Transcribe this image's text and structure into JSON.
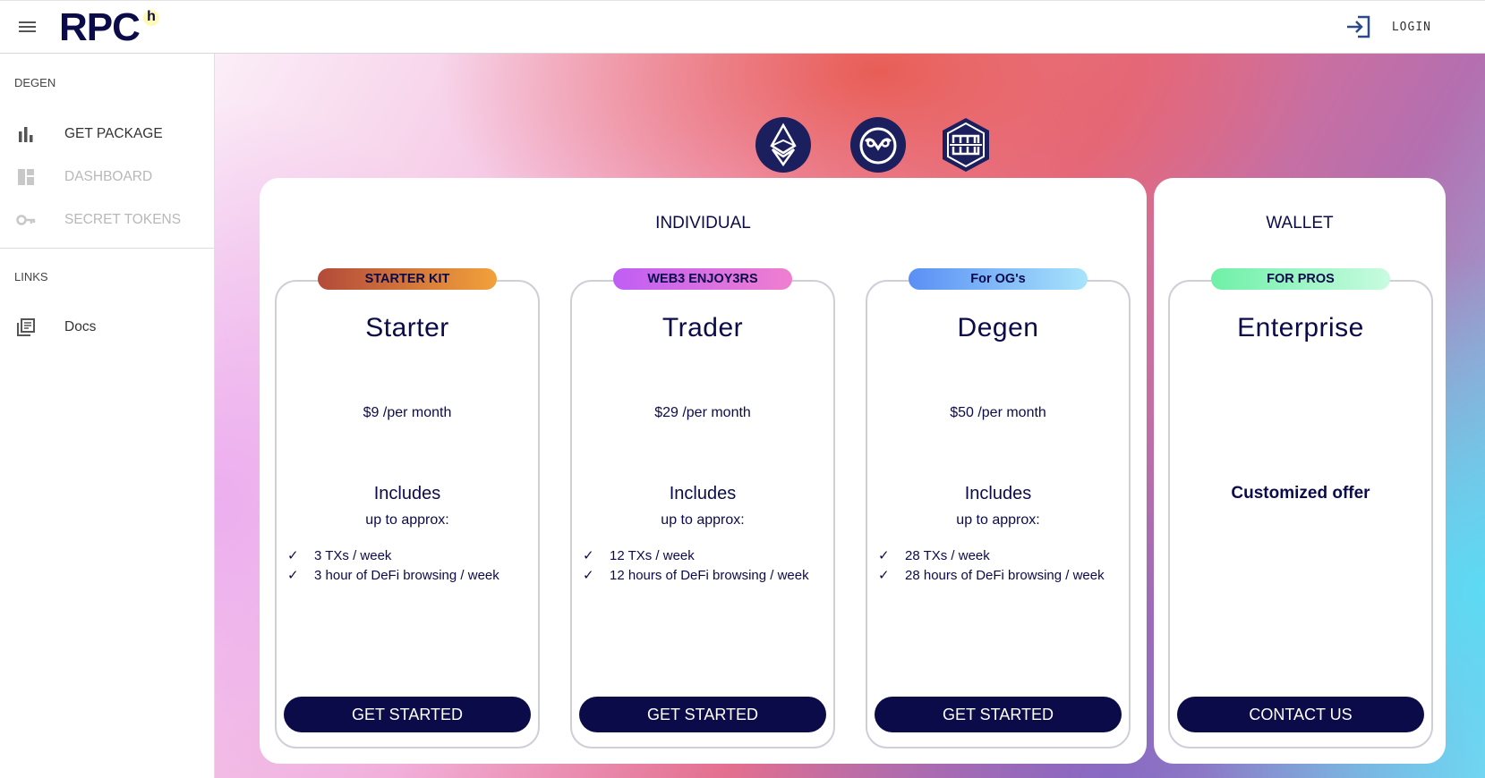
{
  "header": {
    "logo": "RPC",
    "logo_sup": "h",
    "login_label": "LOGIN"
  },
  "sidebar": {
    "section1": "DEGEN",
    "items": [
      {
        "label": "GET PACKAGE",
        "icon": "bar-chart-icon",
        "color": "#333333"
      },
      {
        "label": "DASHBOARD",
        "icon": "dashboard-icon",
        "color": "#b8b8b8"
      },
      {
        "label": "SECRET TOKENS",
        "icon": "key-icon",
        "color": "#b8b8b8"
      }
    ],
    "section2": "LINKS",
    "links": [
      {
        "label": "Docs",
        "icon": "library-books-icon",
        "color": "#333333"
      }
    ]
  },
  "chains": [
    "ethereum-icon",
    "gnosis-icon",
    "hoprnet-icon"
  ],
  "panels": {
    "individual_title": "INDIVIDUAL",
    "wallet_title": "WALLET"
  },
  "plans": [
    {
      "badge": "STARTER KIT",
      "badge_colors": [
        "#b34a3a",
        "#f2a13a"
      ],
      "title": "Starter",
      "price": "$9 /per month",
      "includes": "Includes",
      "includes_sub": "up to approx:",
      "features": [
        "3 TXs / week",
        "3 hour of DeFi browsing / week"
      ],
      "cta": "GET STARTED"
    },
    {
      "badge": "WEB3 ENJOY3RS",
      "badge_colors": [
        "#c05ef5",
        "#f07fcf"
      ],
      "title": "Trader",
      "price": "$29 /per month",
      "includes": "Includes",
      "includes_sub": "up to approx:",
      "features": [
        "12 TXs / week",
        "12 hours of DeFi browsing / week"
      ],
      "cta": "GET STARTED"
    },
    {
      "badge": "For OG's",
      "badge_colors": [
        "#5a8ff5",
        "#a8e4fb"
      ],
      "title": "Degen",
      "price": "$50 /per month",
      "includes": "Includes",
      "includes_sub": "up to approx:",
      "features": [
        "28 TXs / week",
        "28 hours of DeFi browsing / week"
      ],
      "cta": "GET STARTED"
    },
    {
      "badge": "FOR PROS",
      "badge_colors": [
        "#6ff0a8",
        "#c8fbe0"
      ],
      "title": "Enterprise",
      "offer": "Customized offer",
      "cta": "CONTACT US"
    }
  ]
}
